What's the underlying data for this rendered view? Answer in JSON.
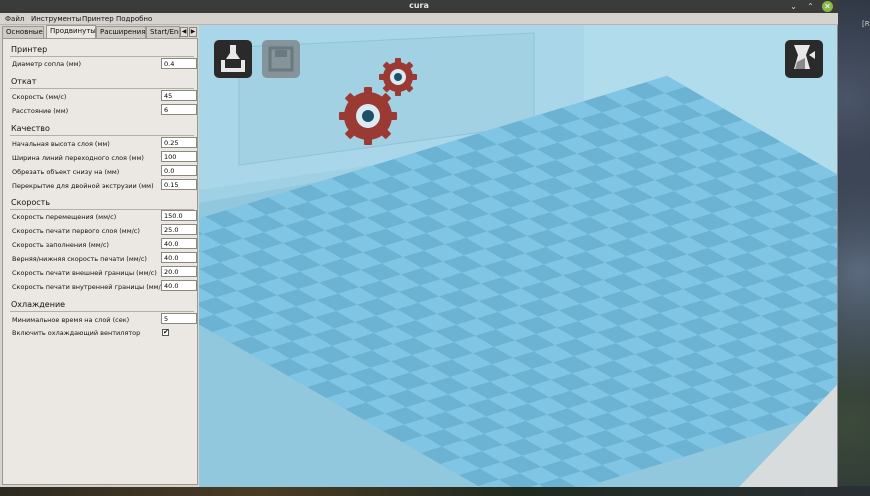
{
  "window": {
    "title": "cura",
    "controls": {
      "minimize": "⌄",
      "maximize": "⌃",
      "close": "✕"
    }
  },
  "menu": [
    "Файл",
    "Инструменты",
    "Принтер",
    "Подробно"
  ],
  "tabs": [
    "Основные",
    "Продвинутые",
    "Расширения",
    "Start/End"
  ],
  "active_tab": "Продвинутые",
  "sections": {
    "printer": {
      "title": "Принтер",
      "rows": [
        {
          "label": "Диаметр сопла (мм)",
          "value": "0.4"
        }
      ]
    },
    "retraction": {
      "title": "Откат",
      "rows": [
        {
          "label": "Скорость (мм/с)",
          "value": "45"
        },
        {
          "label": "Расстояние (мм)",
          "value": "6"
        }
      ]
    },
    "quality": {
      "title": "Качество",
      "rows": [
        {
          "label": "Начальная высота слоя (мм)",
          "value": "0.25"
        },
        {
          "label": "Ширина линий переходного слоя (мм)",
          "value": "100"
        },
        {
          "label": "Обрезать объект снизу на (мм)",
          "value": "0.0"
        },
        {
          "label": "Перекрытие для двойной экструзии (мм)",
          "value": "0.15"
        }
      ]
    },
    "speed": {
      "title": "Скорость",
      "rows": [
        {
          "label": "Скорость перемещения (мм/с)",
          "value": "150.0"
        },
        {
          "label": "Скорость печати первого слоя (мм/с)",
          "value": "25.0"
        },
        {
          "label": "Скорость заполнения (мм/с)",
          "value": "40.0"
        },
        {
          "label": "Верняя/нижняя скорость печати (мм/с)",
          "value": "40.0"
        },
        {
          "label": "Скорость печати внешней границы (мм/с)",
          "value": "20.0"
        },
        {
          "label": "Скорость печати внутренней границы (мм/с)",
          "value": "40.0"
        }
      ]
    },
    "cooling": {
      "title": "Охлаждение",
      "rows": [
        {
          "label": "Минимальное время на слой (сек)",
          "value": "5"
        },
        {
          "label": "Включить охлаждающий вентилятор",
          "checked": true,
          "check_mark": "✔"
        }
      ]
    }
  },
  "viewport": {
    "icons": [
      "load-model-icon",
      "save-gcode-icon",
      "view-mode-icon",
      "loading-gears-icon"
    ],
    "colors": {
      "bed_light": "#80c6e4",
      "bed_dark": "#6cb3d3",
      "wall": "#a6d4e6",
      "gear": "#9b3a33"
    }
  },
  "desktop": {
    "edge_label": "[R"
  }
}
